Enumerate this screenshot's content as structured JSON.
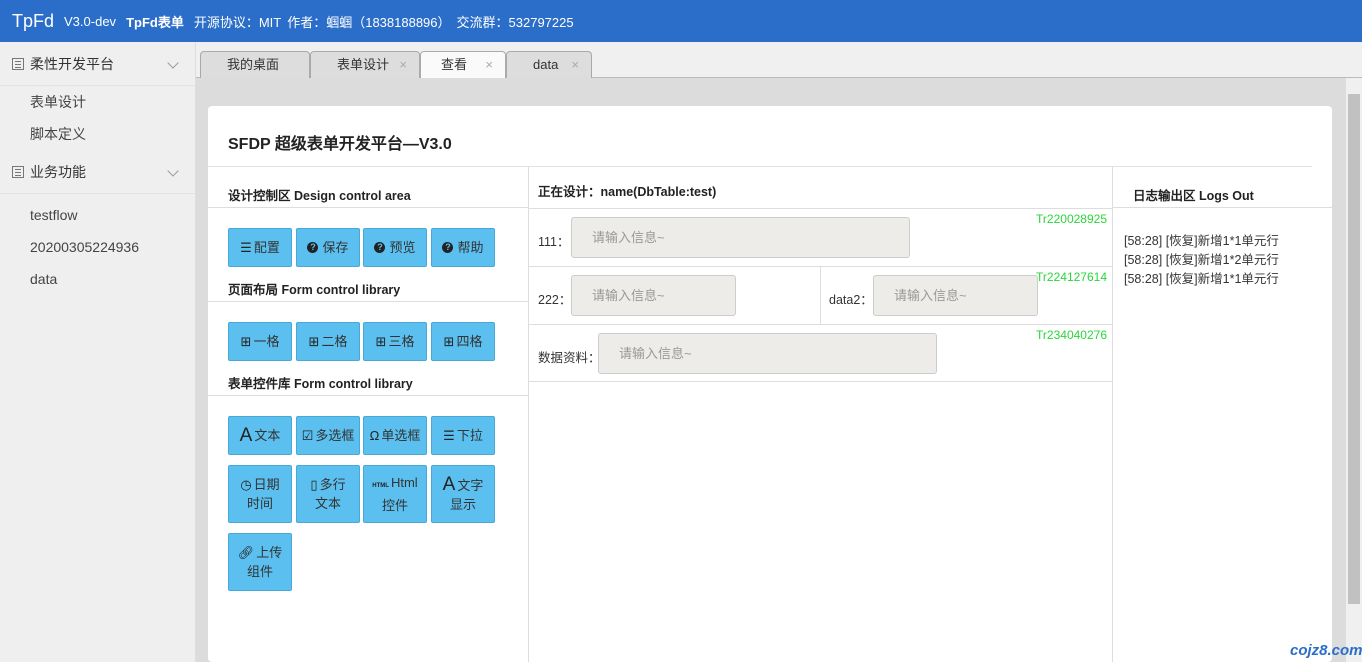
{
  "header": {
    "logo": "TpFd",
    "version": "V3.0-dev",
    "brand": "TpFd表单",
    "license": "开源协议：MIT",
    "author": "作者：蝈蝈（1838188896）",
    "group": "交流群：532797225"
  },
  "sidebar": {
    "groups": [
      {
        "label": "柔性开发平台",
        "icon": "list-icon",
        "items": [
          "表单设计",
          "脚本定义"
        ]
      },
      {
        "label": "业务功能",
        "icon": "list-icon",
        "items": [
          "testflow",
          "20200305224936",
          "data"
        ]
      }
    ]
  },
  "tabs": [
    {
      "label": "我的桌面",
      "closable": false
    },
    {
      "label": "表单设计",
      "closable": true
    },
    {
      "label": "查看",
      "closable": true,
      "active": true
    },
    {
      "label": "data",
      "closable": true
    }
  ],
  "tab_close_glyph": "×",
  "page": {
    "title": "SFDP 超级表单开发平台—V3.0"
  },
  "design_control": {
    "title": "设计控制区 Design control area",
    "buttons": [
      {
        "label": "配置",
        "icon": "list-icon"
      },
      {
        "label": "保存",
        "icon": "question-icon"
      },
      {
        "label": "预览",
        "icon": "question-icon"
      },
      {
        "label": "帮助",
        "icon": "question-icon"
      }
    ]
  },
  "layout_library": {
    "title": "页面布局 Form control library",
    "buttons": [
      {
        "label": "一格",
        "icon": "grid-icon"
      },
      {
        "label": "二格",
        "icon": "grid-icon"
      },
      {
        "label": "三格",
        "icon": "grid-icon"
      },
      {
        "label": "四格",
        "icon": "grid-icon"
      }
    ]
  },
  "control_library": {
    "title": "表单控件库 Form control library",
    "buttons": [
      {
        "label": "文本",
        "icon": "text-icon"
      },
      {
        "label": "多选框",
        "icon": "checkbox-icon"
      },
      {
        "label": "单选框",
        "icon": "radio-icon"
      },
      {
        "label": "下拉",
        "icon": "list-icon"
      },
      {
        "label_1": "日期",
        "label_2": "时间",
        "icon": "clock-icon"
      },
      {
        "label_1": "多行",
        "label_2": "文本",
        "icon": "textarea-icon"
      },
      {
        "label_1": "Html",
        "label_2": "控件",
        "icon": "html-icon"
      },
      {
        "label_1": "文字",
        "label_2": "显示",
        "icon": "text-icon"
      },
      {
        "label_1": "上传",
        "label_2": "组件",
        "icon": "attachment-icon"
      }
    ]
  },
  "design_area": {
    "title": "正在设计：name(DbTable:test)",
    "rows": [
      {
        "id": "Tr220028925",
        "fields": [
          {
            "label": "111：",
            "placeholder": "请输入信息~"
          }
        ]
      },
      {
        "id": "Tr224127614",
        "fields": [
          {
            "label": "222：",
            "placeholder": "请输入信息~"
          },
          {
            "label": "data2：",
            "placeholder": "请输入信息~"
          }
        ]
      },
      {
        "id": "Tr234040276",
        "fields": [
          {
            "label": "数据资料：",
            "placeholder": "请输入信息~"
          }
        ]
      }
    ]
  },
  "logs": {
    "title": "日志输出区 Logs Out",
    "entries": [
      "[58:28] [恢复]新增1*1单元行",
      "[58:28] [恢复]新增1*2单元行",
      "[58:28] [恢复]新增1*1单元行"
    ]
  },
  "watermark": "cojz8.com"
}
